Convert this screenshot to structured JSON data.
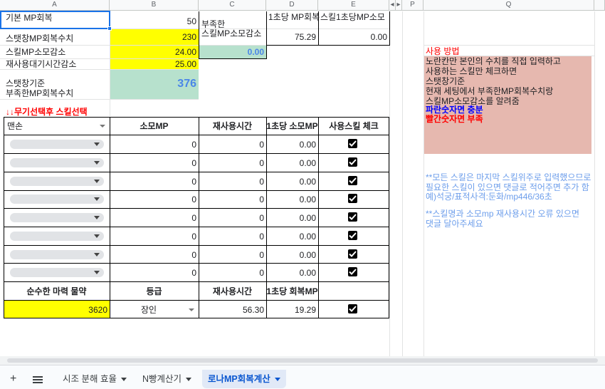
{
  "columns": {
    "A": "A",
    "B": "B",
    "C": "C",
    "D": "D",
    "E": "E",
    "F": "◂",
    "G": "▸",
    "P": "P",
    "Q": "Q"
  },
  "top": {
    "a1": "기본 MP회복",
    "b1": "50",
    "a2": "스탯창MP회복수치",
    "b2": "230",
    "a3": "스킬MP소모감소",
    "b3": "24.00",
    "a4": "재사용대기시간감소",
    "b4": "25.00",
    "a5_l1": "스탯창기준",
    "a5_l2": "부족한MP회복수치",
    "b5": "376",
    "c_l1": "부족한",
    "c_l2": "스킬MP소모감소",
    "c3": "0.00",
    "d1": "1초당 MP회복",
    "d2": "75.29",
    "e1": "스킬1초당MP소모",
    "e2": "0.00"
  },
  "warning": "↓↓무기선택후 스킬선택",
  "skill_table": {
    "weapon": "맨손",
    "headers": [
      "소모MP",
      "재사용시간",
      "1초당 소모MP",
      "사용스킬 체크"
    ],
    "rows": [
      {
        "mp": "0",
        "cd": "0",
        "per": "0.00"
      },
      {
        "mp": "0",
        "cd": "0",
        "per": "0.00"
      },
      {
        "mp": "0",
        "cd": "0",
        "per": "0.00"
      },
      {
        "mp": "0",
        "cd": "0",
        "per": "0.00"
      },
      {
        "mp": "0",
        "cd": "0",
        "per": "0.00"
      },
      {
        "mp": "0",
        "cd": "0",
        "per": "0.00"
      },
      {
        "mp": "0",
        "cd": "0",
        "per": "0.00"
      },
      {
        "mp": "0",
        "cd": "0",
        "per": "0.00"
      }
    ]
  },
  "potion_table": {
    "headers": [
      "순수한 마력 물약",
      "등급",
      "재사용시간",
      "1초당 회복MP"
    ],
    "amount": "3620",
    "grade": "장인",
    "cooldown": "56.30",
    "per_sec": "19.29"
  },
  "notes": {
    "title": "사용 방법",
    "lines": [
      "노란칸만 본인의 수치를 직접 입력하고",
      "사용하는 스킬만 체크하면",
      "스탯창기준",
      "현재 세팅에서 부족한MP회복수치랑",
      "스킬MP소모감소를 알려줌"
    ],
    "blue": "파란숫자면 충분",
    "red": "빨간숫자면 부족",
    "note1": [
      "**모든 스킬은 마지막 스킬위주로 입력했으므로",
      "필요한 스킬이 있으면 댓글로 적어주면 추가 함",
      "예)석궁/표적사격:둔화/mp446/36초"
    ],
    "note2": [
      "**스킬명과 소모mp 재사용시간 오류 있으면",
      "댓글 달아주세요"
    ]
  },
  "tabs": [
    "시조 분해 효율",
    "N빵계산기",
    "로나MP회복계산"
  ],
  "colors": {
    "yellow": "#ffff00",
    "green": "#b7e1cd",
    "pink": "#e6b8af",
    "blue_value": "#4a86e8",
    "red": "#ff0000"
  }
}
